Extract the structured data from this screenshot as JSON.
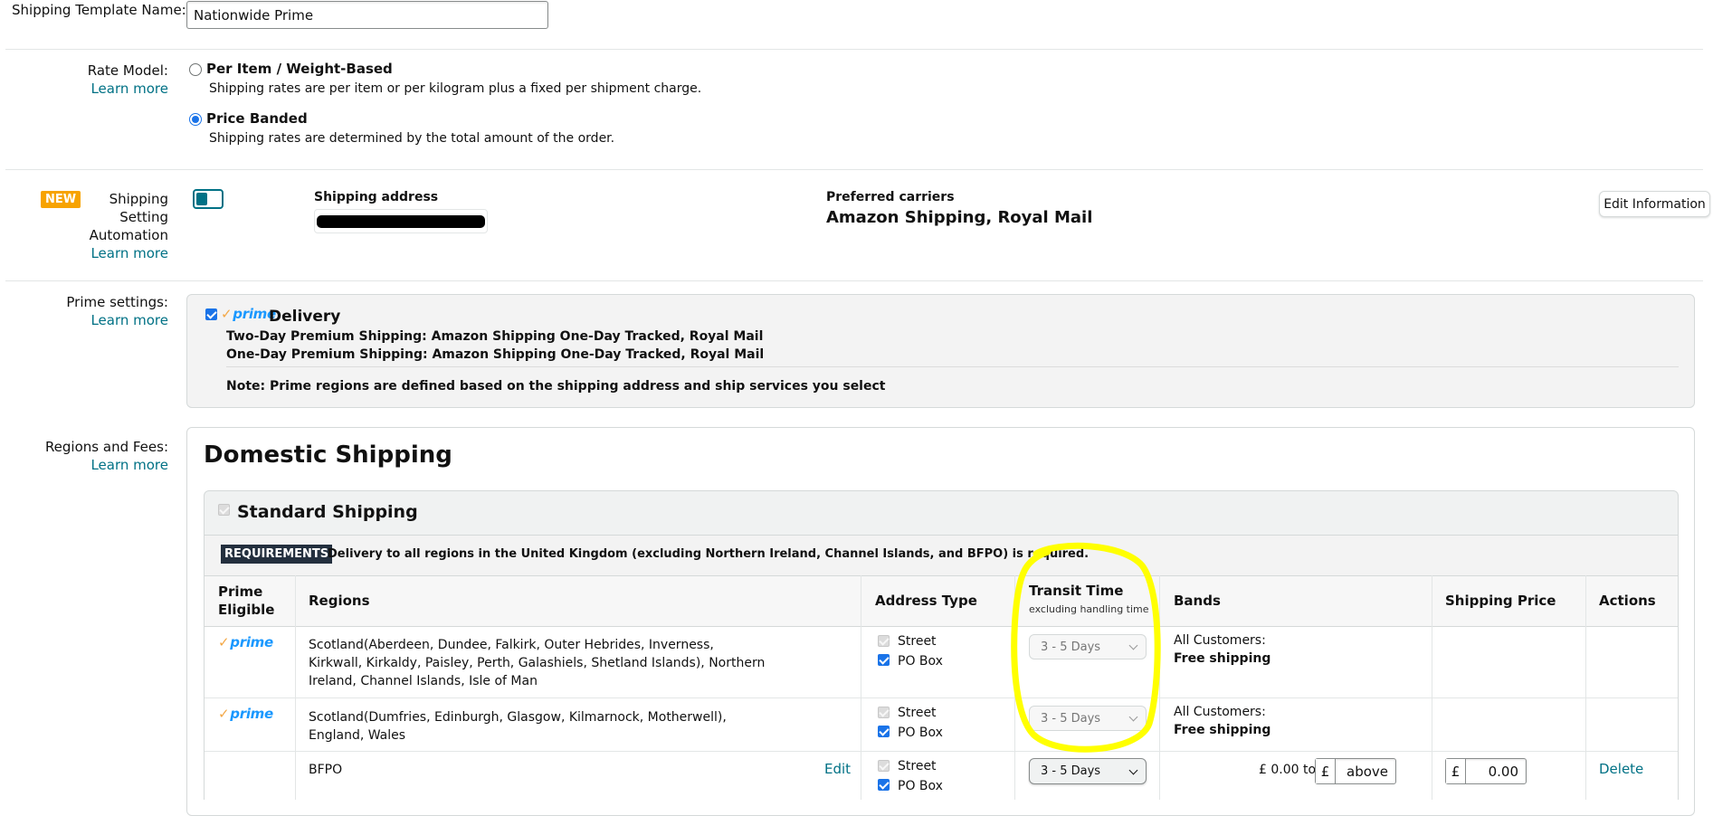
{
  "template_name": {
    "label": "Shipping Template Name:",
    "value": "Nationwide Prime"
  },
  "rate_model": {
    "label": "Rate Model:",
    "learn_more": "Learn more",
    "options": [
      {
        "title": "Per Item / Weight-Based",
        "desc": "Shipping rates are per item or per kilogram plus a fixed per shipment charge.",
        "selected": false
      },
      {
        "title": "Price Banded",
        "desc": "Shipping rates are determined by the total amount of the order.",
        "selected": true
      }
    ]
  },
  "automation": {
    "badge": "NEW",
    "label_lines": [
      "Shipping",
      "Setting",
      "Automation"
    ],
    "learn_more": "Learn more",
    "toggle_on": true,
    "address_label": "Shipping address",
    "carriers_label": "Preferred carriers",
    "carriers_value": "Amazon Shipping, Royal Mail",
    "edit_button": "Edit Information"
  },
  "prime_settings": {
    "label": "Prime settings:",
    "learn_more": "Learn more",
    "checked": true,
    "prime_logo": "prime",
    "delivery": "Delivery",
    "two_day": "Two-Day Premium Shipping: Amazon Shipping One-Day Tracked, Royal Mail",
    "one_day": "One-Day Premium Shipping: Amazon Shipping One-Day Tracked, Royal Mail",
    "note": "Note: Prime regions are defined based on the shipping address and ship services you select"
  },
  "regions": {
    "label": "Regions and Fees:",
    "learn_more": "Learn more",
    "heading": "Domestic Shipping",
    "standard": "Standard Shipping",
    "req_badge": "REQUIREMENTS",
    "req_text": "Delivery to all regions in the United Kingdom (excluding Northern Ireland, Channel Islands, and BFPO) is required.",
    "columns": {
      "prime_eligible_1": "Prime",
      "prime_eligible_2": "Eligible",
      "regions": "Regions",
      "address_type": "Address Type",
      "transit_time": "Transit Time",
      "transit_sub": "excluding handling time",
      "bands": "Bands",
      "shipping_price": "Shipping Price",
      "actions": "Actions"
    },
    "rows": [
      {
        "prime": "prime",
        "region_lines": [
          "Scotland(Aberdeen, Dundee, Falkirk, Outer Hebrides, Inverness,",
          "Kirkwall, Kirkaldy, Paisley, Perth, Galashiels, Shetland Islands), Northern",
          "Ireland, Channel Islands, Isle of Man"
        ],
        "street": "Street",
        "po_box": "PO Box",
        "transit": "3 - 5 Days",
        "bands_label": "All Customers:",
        "bands_value": "Free shipping"
      },
      {
        "prime": "prime",
        "region_lines": [
          "Scotland(Dumfries, Edinburgh, Glasgow, Kilmarnock, Motherwell),",
          "England, Wales"
        ],
        "street": "Street",
        "po_box": "PO Box",
        "transit": "3 - 5 Days",
        "bands_label": "All Customers:",
        "bands_value": "Free shipping"
      },
      {
        "region": "BFPO",
        "edit": "Edit",
        "street": "Street",
        "po_box": "PO Box",
        "transit": "3 - 5 Days",
        "band_from": "£ 0.00 to",
        "currency": "£",
        "band_to": "above",
        "price": "0.00",
        "delete": "Delete"
      }
    ]
  },
  "colors": {
    "link": "#007185",
    "highlight": "#ffff00",
    "badge": "#f7a300",
    "prime_blue": "#1a98ff",
    "prime_check": "#f3a847"
  }
}
